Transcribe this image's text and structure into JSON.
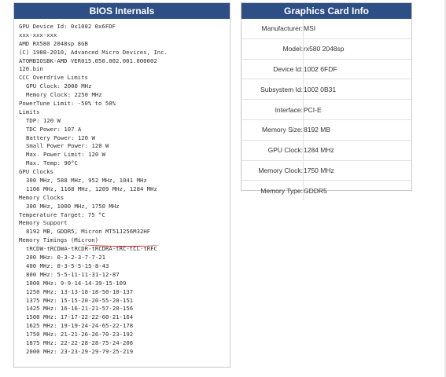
{
  "bios": {
    "title": "BIOS Internals",
    "lines": [
      {
        "t": "GPU Device Id: 0x1002 0x6FDF",
        "i": 0
      },
      {
        "t": "xxx-xxx-xxx",
        "i": 0
      },
      {
        "t": "AMD RX580 2048sp 8GB",
        "i": 0
      },
      {
        "t": "(C) 1988-2010, Advanced Micro Devices, Inc.",
        "i": 0
      },
      {
        "t": "ATOMBIOSBK-AMD VER015.050.002.001.000002",
        "i": 0
      },
      {
        "t": "120.bin",
        "i": 0
      },
      {
        "t": "CCC Overdrive Limits",
        "i": 0
      },
      {
        "t": "GPU Clock: 2000 MHz",
        "i": 1
      },
      {
        "t": "Memory Clock: 2250 MHz",
        "i": 1
      },
      {
        "t": "PowerTune Limit: -50% to 50%",
        "i": 0
      },
      {
        "t": "Limits",
        "i": 0
      },
      {
        "t": "TDP: 120 W",
        "i": 1
      },
      {
        "t": "TDC Power: 107 A",
        "i": 1
      },
      {
        "t": "Battery Power: 120 W",
        "i": 1
      },
      {
        "t": "Small Power Power: 120 W",
        "i": 1
      },
      {
        "t": "Max. Power Limit: 120 W",
        "i": 1
      },
      {
        "t": "Max. Temp: 90°C",
        "i": 1
      },
      {
        "t": "GPU Clocks",
        "i": 0
      },
      {
        "t": "300 MHz, 588 MHz, 952 MHz, 1041 MHz",
        "i": 1
      },
      {
        "t": "1106 MHz, 1168 MHz, 1209 MHz, 1284 MHz",
        "i": 1
      },
      {
        "t": "Memory Clocks",
        "i": 0
      },
      {
        "t": "300 MHz, 1000 MHz, 1750 MHz",
        "i": 1
      },
      {
        "t": "Temperature Target: 75 °C",
        "i": 0
      },
      {
        "t": "Memory Support",
        "i": 0
      },
      {
        "t": "8192 MB, GDDR5, Micron MT51J256M32HF",
        "i": 1
      },
      {
        "t": "Memory Timings (Micron)",
        "i": 0
      },
      {
        "t": "tRCDW-tRCDWA-tRCDR-tRCDRA-tRC-tCL-tRFC",
        "i": 1
      },
      {
        "t": "200 MHz: 0-3-2-3-7-7-21",
        "i": 1
      },
      {
        "t": "400 MHz: 0-3-5-5-15-8-43",
        "i": 1
      },
      {
        "t": "800 MHz: 5-5-11-11-31-12-87",
        "i": 1
      },
      {
        "t": "1000 MHz: 9-9-14-14-39-15-109",
        "i": 1
      },
      {
        "t": "1250 MHz: 13-13-18-18-50-18-137",
        "i": 1
      },
      {
        "t": "1375 MHz: 15-15-20-20-55-20-151",
        "i": 1
      },
      {
        "t": "1425 MHz: 16-16-21-21-57-20-156",
        "i": 1
      },
      {
        "t": "1500 MHz: 17-17-22-22-60-21-164",
        "i": 1
      },
      {
        "t": "1625 MHz: 19-19-24-24-65-22-178",
        "i": 1
      },
      {
        "t": "1750 MHz: 21-21-26-26-70-23-192",
        "i": 1
      },
      {
        "t": "1875 MHz: 22-22-28-28-75-24-206",
        "i": 1
      },
      {
        "t": "2000 MHz: 23-23-29-29-79-25-219",
        "i": 1
      }
    ]
  },
  "graphics_card": {
    "title": "Graphics Card Info",
    "rows": [
      {
        "label": "Manufacturer:",
        "value": "MSI"
      },
      {
        "label": "Model:",
        "value": "rx580 2048sp"
      },
      {
        "label": "Device Id:",
        "value": "1002 6FDF"
      },
      {
        "label": "Subsystem Id:",
        "value": "1002 0B31"
      },
      {
        "label": "Interface:",
        "value": "PCI-E"
      },
      {
        "label": "Memory Size:",
        "value": "8192 MB"
      },
      {
        "label": "GPU Clock:",
        "value": "1284 MHz"
      },
      {
        "label": "Memory Clock:",
        "value": "1750 MHz"
      },
      {
        "label": "Memory Type:",
        "value": "GDDR5"
      }
    ]
  },
  "colors": {
    "header_bg": "#2e4e86",
    "annotation": "#d71a1a"
  }
}
